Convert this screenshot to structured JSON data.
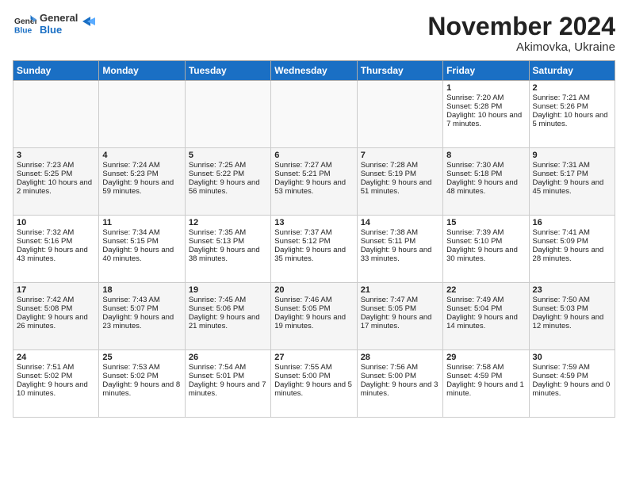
{
  "logo": {
    "general": "General",
    "blue": "Blue"
  },
  "header": {
    "month": "November 2024",
    "location": "Akimovka, Ukraine"
  },
  "days_of_week": [
    "Sunday",
    "Monday",
    "Tuesday",
    "Wednesday",
    "Thursday",
    "Friday",
    "Saturday"
  ],
  "weeks": [
    [
      {
        "day": "",
        "info": ""
      },
      {
        "day": "",
        "info": ""
      },
      {
        "day": "",
        "info": ""
      },
      {
        "day": "",
        "info": ""
      },
      {
        "day": "",
        "info": ""
      },
      {
        "day": "1",
        "info": "Sunrise: 7:20 AM\nSunset: 5:28 PM\nDaylight: 10 hours and 7 minutes."
      },
      {
        "day": "2",
        "info": "Sunrise: 7:21 AM\nSunset: 5:26 PM\nDaylight: 10 hours and 5 minutes."
      }
    ],
    [
      {
        "day": "3",
        "info": "Sunrise: 7:23 AM\nSunset: 5:25 PM\nDaylight: 10 hours and 2 minutes."
      },
      {
        "day": "4",
        "info": "Sunrise: 7:24 AM\nSunset: 5:23 PM\nDaylight: 9 hours and 59 minutes."
      },
      {
        "day": "5",
        "info": "Sunrise: 7:25 AM\nSunset: 5:22 PM\nDaylight: 9 hours and 56 minutes."
      },
      {
        "day": "6",
        "info": "Sunrise: 7:27 AM\nSunset: 5:21 PM\nDaylight: 9 hours and 53 minutes."
      },
      {
        "day": "7",
        "info": "Sunrise: 7:28 AM\nSunset: 5:19 PM\nDaylight: 9 hours and 51 minutes."
      },
      {
        "day": "8",
        "info": "Sunrise: 7:30 AM\nSunset: 5:18 PM\nDaylight: 9 hours and 48 minutes."
      },
      {
        "day": "9",
        "info": "Sunrise: 7:31 AM\nSunset: 5:17 PM\nDaylight: 9 hours and 45 minutes."
      }
    ],
    [
      {
        "day": "10",
        "info": "Sunrise: 7:32 AM\nSunset: 5:16 PM\nDaylight: 9 hours and 43 minutes."
      },
      {
        "day": "11",
        "info": "Sunrise: 7:34 AM\nSunset: 5:15 PM\nDaylight: 9 hours and 40 minutes."
      },
      {
        "day": "12",
        "info": "Sunrise: 7:35 AM\nSunset: 5:13 PM\nDaylight: 9 hours and 38 minutes."
      },
      {
        "day": "13",
        "info": "Sunrise: 7:37 AM\nSunset: 5:12 PM\nDaylight: 9 hours and 35 minutes."
      },
      {
        "day": "14",
        "info": "Sunrise: 7:38 AM\nSunset: 5:11 PM\nDaylight: 9 hours and 33 minutes."
      },
      {
        "day": "15",
        "info": "Sunrise: 7:39 AM\nSunset: 5:10 PM\nDaylight: 9 hours and 30 minutes."
      },
      {
        "day": "16",
        "info": "Sunrise: 7:41 AM\nSunset: 5:09 PM\nDaylight: 9 hours and 28 minutes."
      }
    ],
    [
      {
        "day": "17",
        "info": "Sunrise: 7:42 AM\nSunset: 5:08 PM\nDaylight: 9 hours and 26 minutes."
      },
      {
        "day": "18",
        "info": "Sunrise: 7:43 AM\nSunset: 5:07 PM\nDaylight: 9 hours and 23 minutes."
      },
      {
        "day": "19",
        "info": "Sunrise: 7:45 AM\nSunset: 5:06 PM\nDaylight: 9 hours and 21 minutes."
      },
      {
        "day": "20",
        "info": "Sunrise: 7:46 AM\nSunset: 5:05 PM\nDaylight: 9 hours and 19 minutes."
      },
      {
        "day": "21",
        "info": "Sunrise: 7:47 AM\nSunset: 5:05 PM\nDaylight: 9 hours and 17 minutes."
      },
      {
        "day": "22",
        "info": "Sunrise: 7:49 AM\nSunset: 5:04 PM\nDaylight: 9 hours and 14 minutes."
      },
      {
        "day": "23",
        "info": "Sunrise: 7:50 AM\nSunset: 5:03 PM\nDaylight: 9 hours and 12 minutes."
      }
    ],
    [
      {
        "day": "24",
        "info": "Sunrise: 7:51 AM\nSunset: 5:02 PM\nDaylight: 9 hours and 10 minutes."
      },
      {
        "day": "25",
        "info": "Sunrise: 7:53 AM\nSunset: 5:02 PM\nDaylight: 9 hours and 8 minutes."
      },
      {
        "day": "26",
        "info": "Sunrise: 7:54 AM\nSunset: 5:01 PM\nDaylight: 9 hours and 7 minutes."
      },
      {
        "day": "27",
        "info": "Sunrise: 7:55 AM\nSunset: 5:00 PM\nDaylight: 9 hours and 5 minutes."
      },
      {
        "day": "28",
        "info": "Sunrise: 7:56 AM\nSunset: 5:00 PM\nDaylight: 9 hours and 3 minutes."
      },
      {
        "day": "29",
        "info": "Sunrise: 7:58 AM\nSunset: 4:59 PM\nDaylight: 9 hours and 1 minute."
      },
      {
        "day": "30",
        "info": "Sunrise: 7:59 AM\nSunset: 4:59 PM\nDaylight: 9 hours and 0 minutes."
      }
    ]
  ]
}
